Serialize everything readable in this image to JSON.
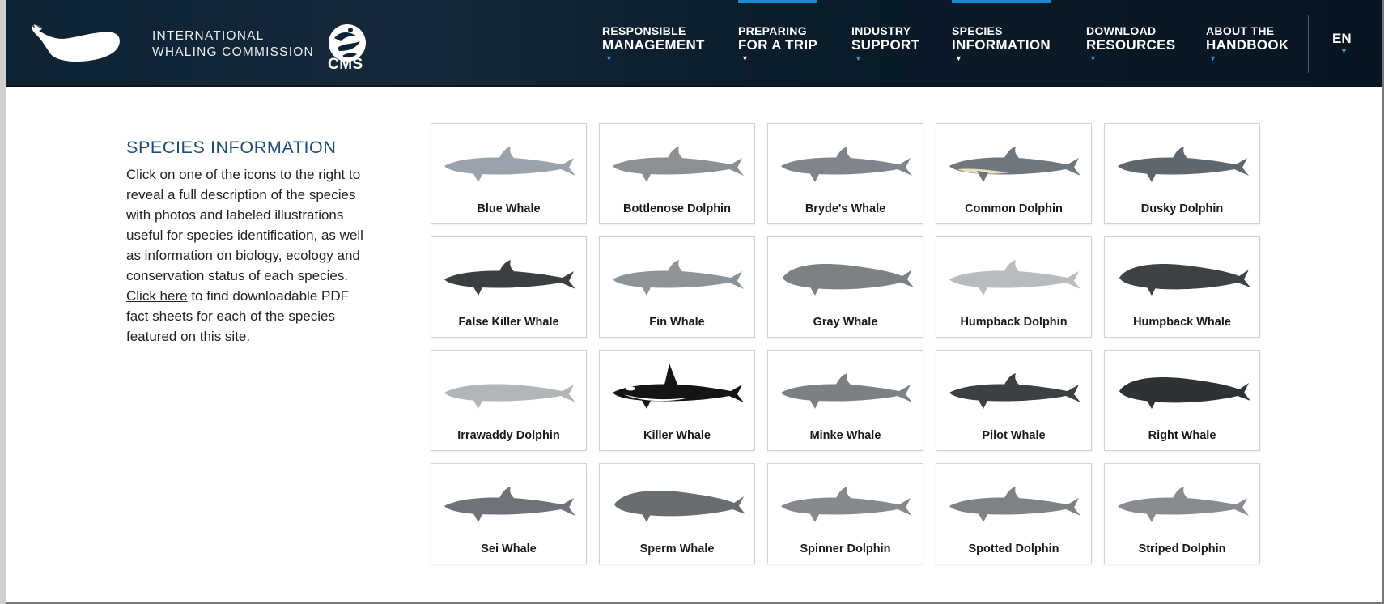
{
  "brand": {
    "org_line1": "INTERNATIONAL",
    "org_line2": "WHALING COMMISSION",
    "partner": "CMS"
  },
  "nav": [
    {
      "line1": "RESPONSIBLE",
      "line2": "MANAGEMENT",
      "active": false
    },
    {
      "line1": "PREPARING",
      "line2": "FOR A TRIP",
      "active": true
    },
    {
      "line1": "INDUSTRY",
      "line2": "SUPPORT",
      "active": false
    },
    {
      "line1": "SPECIES",
      "line2": "INFORMATION",
      "active": true
    },
    {
      "line1": "DOWNLOAD",
      "line2": "RESOURCES",
      "active": false
    },
    {
      "line1": "ABOUT THE",
      "line2": "HANDBOOK",
      "active": false
    }
  ],
  "language": "EN",
  "main": {
    "title": "SPECIES INFORMATION",
    "intro": "Click on one of the icons to the right to reveal a full description of the species with photos and labeled illustrations useful for species identification, as well as information on biology, ecology and conservation status of each species.",
    "link_text": "Click here",
    "link_suffix": "to find downloadable PDF fact sheets for each of the species featured on this site."
  },
  "species": [
    "Blue Whale",
    "Bottlenose Dolphin",
    "Bryde's Whale",
    "Common Dolphin",
    "Dusky Dolphin",
    "False Killer Whale",
    "Fin Whale",
    "Gray Whale",
    "Humpback Dolphin",
    "Humpback Whale",
    "Irrawaddy Dolphin",
    "Killer Whale",
    "Minke Whale",
    "Pilot Whale",
    "Right Whale",
    "Sei Whale",
    "Sperm Whale",
    "Spinner Dolphin",
    "Spotted Dolphin",
    "Striped Dolphin"
  ],
  "colors": {
    "header_bg": "#0d2232",
    "accent": "#1a8ad1",
    "title": "#1e4d73"
  }
}
